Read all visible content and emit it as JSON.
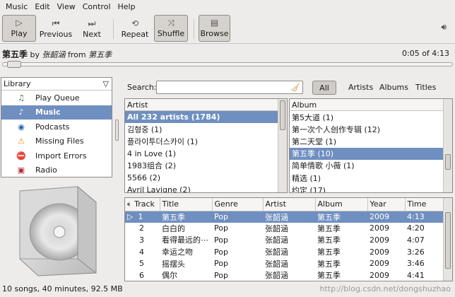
{
  "menu": [
    "Music",
    "Edit",
    "View",
    "Control",
    "Help"
  ],
  "toolbar": {
    "play": "Play",
    "previous": "Previous",
    "next": "Next",
    "repeat": "Repeat",
    "shuffle": "Shuffle",
    "browse": "Browse"
  },
  "now_playing": {
    "song": "第五季",
    "by": "by",
    "artist": "张韶涵",
    "from": "from",
    "album": "第五季",
    "time": "0:05 of 4:13",
    "progress": 0.02
  },
  "library": {
    "title": "Library",
    "items": [
      "Play Queue",
      "Music",
      "Podcasts",
      "Missing Files",
      "Import Errors",
      "Radio"
    ]
  },
  "search": {
    "label": "Search:",
    "value": ""
  },
  "filters": [
    "All",
    "Artists",
    "Albums",
    "Titles"
  ],
  "artist_pane": {
    "header": "Artist",
    "rows": [
      "All 232 artists (1784)",
      "김형중 (1)",
      "플라이투더스카이 (1)",
      "4 in Love (1)",
      "1983组合 (2)",
      "5566 (2)",
      "Avril Lavigne (2)"
    ]
  },
  "album_pane": {
    "header": "Album",
    "rows": [
      "第5大道 (1)",
      "第一次个人创作专辑 (12)",
      "第二天堂 (1)",
      "第五季 (10)",
      "简单情歌 小薇 (1)",
      "精选 (1)",
      "约定 (17)"
    ]
  },
  "songs": {
    "columns": [
      "Track",
      "Title",
      "Genre",
      "Artist",
      "Album",
      "Year",
      "Time"
    ],
    "rows": [
      [
        "1",
        "第五季",
        "Pop",
        "张韶涵",
        "第五季",
        "2009",
        "4:13"
      ],
      [
        "2",
        "白白的",
        "Pop",
        "张韶涵",
        "第五季",
        "2009",
        "4:20"
      ],
      [
        "3",
        "看得最远的⋯",
        "Pop",
        "张韶涵",
        "第五季",
        "2009",
        "4:07"
      ],
      [
        "4",
        "幸运之吻",
        "Pop",
        "张韶涵",
        "第五季",
        "2009",
        "3:26"
      ],
      [
        "5",
        "摇摆头",
        "Pop",
        "张韶涵",
        "第五季",
        "2009",
        "3:46"
      ],
      [
        "6",
        "偶尔",
        "Pop",
        "张韶涵",
        "第五季",
        "2009",
        "4:41"
      ]
    ]
  },
  "status": "10 songs, 40 minutes, 92.5 MB",
  "watermark": "http://blog.csdn.net/dongshuzhao",
  "colors": {
    "selection": "#6f8fc0"
  }
}
